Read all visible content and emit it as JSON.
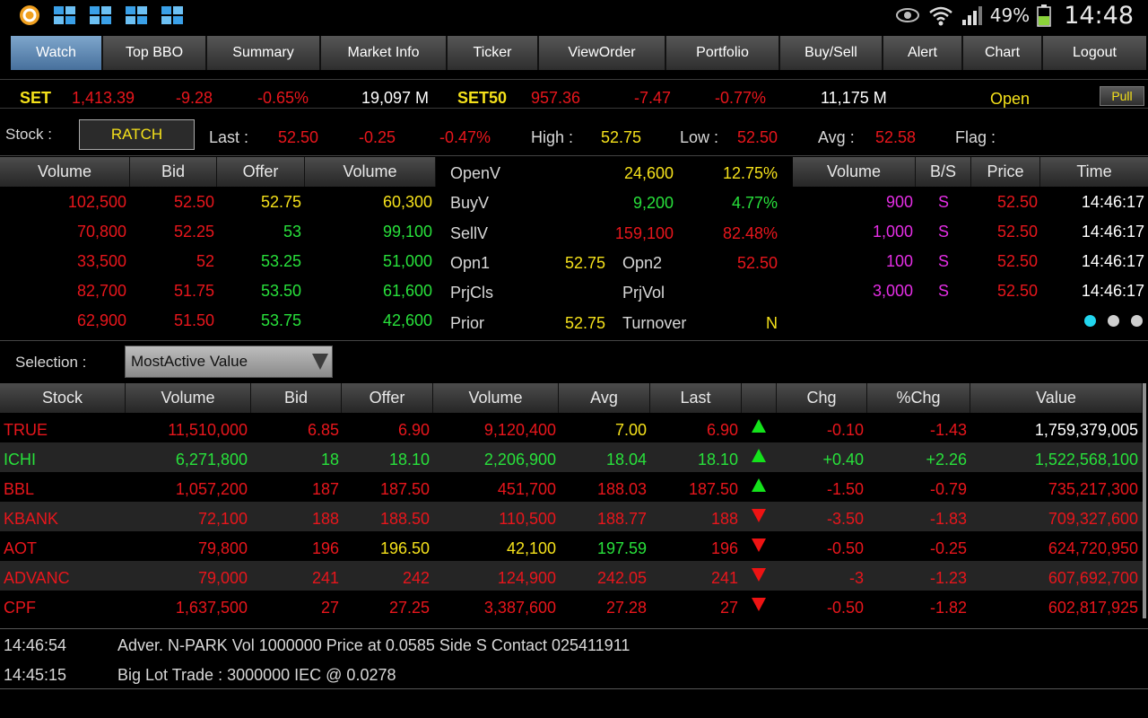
{
  "statusbar": {
    "apps": [
      "circle-app-icon",
      "stacked-boxes-icon",
      "stacked-boxes-icon",
      "stacked-boxes-icon",
      "stacked-boxes-icon"
    ],
    "battery_pct": "49%",
    "clock": "14:48"
  },
  "nav": {
    "tabs": [
      "Watch",
      "Top BBO",
      "Summary",
      "Market Info",
      "Ticker",
      "ViewOrder",
      "Portfolio",
      "Buy/Sell",
      "Alert",
      "Chart",
      "Logout"
    ],
    "active": "Watch"
  },
  "index": {
    "set_name": "SET",
    "set_value": "1,413.39",
    "set_chg": "-9.28",
    "set_pct": "-0.65%",
    "set_vol": "19,097 M",
    "set50_name": "SET50",
    "set50_value": "957.36",
    "set50_chg": "-7.47",
    "set50_pct": "-0.77%",
    "set50_vol": "11,175 M",
    "market_status": "Open",
    "pull_label": "Pull"
  },
  "stock": {
    "label": "Stock :",
    "symbol": "RATCH",
    "last_label": "Last :",
    "last": "52.50",
    "chg": "-0.25",
    "pct": "-0.47%",
    "high_label": "High :",
    "high": "52.75",
    "low_label": "Low :",
    "low": "52.50",
    "avg_label": "Avg :",
    "avg": "52.58",
    "flag_label": "Flag :"
  },
  "bidoffer": {
    "headers": [
      "Volume",
      "Bid",
      "Offer",
      "Volume"
    ],
    "rows": [
      {
        "bid_vol": "102,500",
        "bid": "52.50",
        "offer": "52.75",
        "offer_vol": "60,300"
      },
      {
        "bid_vol": "70,800",
        "bid": "52.25",
        "offer": "53",
        "offer_vol": "99,100"
      },
      {
        "bid_vol": "33,500",
        "bid": "52",
        "offer": "53.25",
        "offer_vol": "51,000"
      },
      {
        "bid_vol": "82,700",
        "bid": "51.75",
        "offer": "53.50",
        "offer_vol": "61,600"
      },
      {
        "bid_vol": "62,900",
        "bid": "51.50",
        "offer": "53.75",
        "offer_vol": "42,600"
      }
    ]
  },
  "info": {
    "openv_label": "OpenV",
    "openv": "24,600",
    "openv_pct": "12.75%",
    "buyv_label": "BuyV",
    "buyv": "9,200",
    "buyv_pct": "4.77%",
    "sellv_label": "SellV",
    "sellv": "159,100",
    "sellv_pct": "82.48%",
    "opn1_label": "Opn1",
    "opn1": "52.75",
    "opn2_label": "Opn2",
    "opn2": "52.50",
    "prjcls_label": "PrjCls",
    "prjvol_label": "PrjVol",
    "prior_label": "Prior",
    "prior": "52.75",
    "turnover_label": "Turnover",
    "turnover": "N"
  },
  "ticker": {
    "headers": [
      "Volume",
      "B/S",
      "Price",
      "Time"
    ],
    "rows": [
      {
        "volume": "900",
        "side": "S",
        "price": "52.50",
        "time": "14:46:17"
      },
      {
        "volume": "1,000",
        "side": "S",
        "price": "52.50",
        "time": "14:46:17"
      },
      {
        "volume": "100",
        "side": "S",
        "price": "52.50",
        "time": "14:46:17"
      },
      {
        "volume": "3,000",
        "side": "S",
        "price": "52.50",
        "time": "14:46:17"
      }
    ]
  },
  "selection": {
    "label": "Selection :",
    "value": "MostActive Value"
  },
  "mostactive": {
    "headers": [
      "Stock",
      "Volume",
      "Bid",
      "Offer",
      "Volume",
      "Avg",
      "Last",
      "",
      "Chg",
      "%Chg",
      "Value"
    ],
    "rows": [
      {
        "stock": "TRUE",
        "volume": "11,510,000",
        "bid": "6.85",
        "offer": "6.90",
        "offer_vol": "9,120,400",
        "avg": "7.00",
        "last": "6.90",
        "dir": "up",
        "chg": "-0.10",
        "pct": "-1.43",
        "value": "1,759,379,005"
      },
      {
        "stock": "ICHI",
        "volume": "6,271,800",
        "bid": "18",
        "offer": "18.10",
        "offer_vol": "2,206,900",
        "avg": "18.04",
        "last": "18.10",
        "dir": "up",
        "chg": "+0.40",
        "pct": "+2.26",
        "value": "1,522,568,100"
      },
      {
        "stock": "BBL",
        "volume": "1,057,200",
        "bid": "187",
        "offer": "187.50",
        "offer_vol": "451,700",
        "avg": "188.03",
        "last": "187.50",
        "dir": "up",
        "chg": "-1.50",
        "pct": "-0.79",
        "value": "735,217,300"
      },
      {
        "stock": "KBANK",
        "volume": "72,100",
        "bid": "188",
        "offer": "188.50",
        "offer_vol": "110,500",
        "avg": "188.77",
        "last": "188",
        "dir": "down",
        "chg": "-3.50",
        "pct": "-1.83",
        "value": "709,327,600"
      },
      {
        "stock": "AOT",
        "volume": "79,800",
        "bid": "196",
        "offer": "196.50",
        "offer_vol": "42,100",
        "avg": "197.59",
        "last": "196",
        "dir": "down",
        "chg": "-0.50",
        "pct": "-0.25",
        "value": "624,720,950"
      },
      {
        "stock": "ADVANC",
        "volume": "79,000",
        "bid": "241",
        "offer": "242",
        "offer_vol": "124,900",
        "avg": "242.05",
        "last": "241",
        "dir": "down",
        "chg": "-3",
        "pct": "-1.23",
        "value": "607,692,700"
      },
      {
        "stock": "CPF",
        "volume": "1,637,500",
        "bid": "27",
        "offer": "27.25",
        "offer_vol": "3,387,600",
        "avg": "27.28",
        "last": "27",
        "dir": "down",
        "chg": "-0.50",
        "pct": "-1.82",
        "value": "602,817,925"
      }
    ]
  },
  "news": [
    {
      "time": "14:46:54",
      "text": "Adver. N-PARK Vol 1000000 Price at 0.0585 Side S Contact 025411911"
    },
    {
      "time": "14:45:15",
      "text": "Big Lot Trade : 3000000 IEC @ 0.0278"
    }
  ],
  "colors": {
    "up": "#28e03b",
    "down": "#e8161c",
    "unchanged": "#f5e11b",
    "accent": "#5b86b4"
  }
}
